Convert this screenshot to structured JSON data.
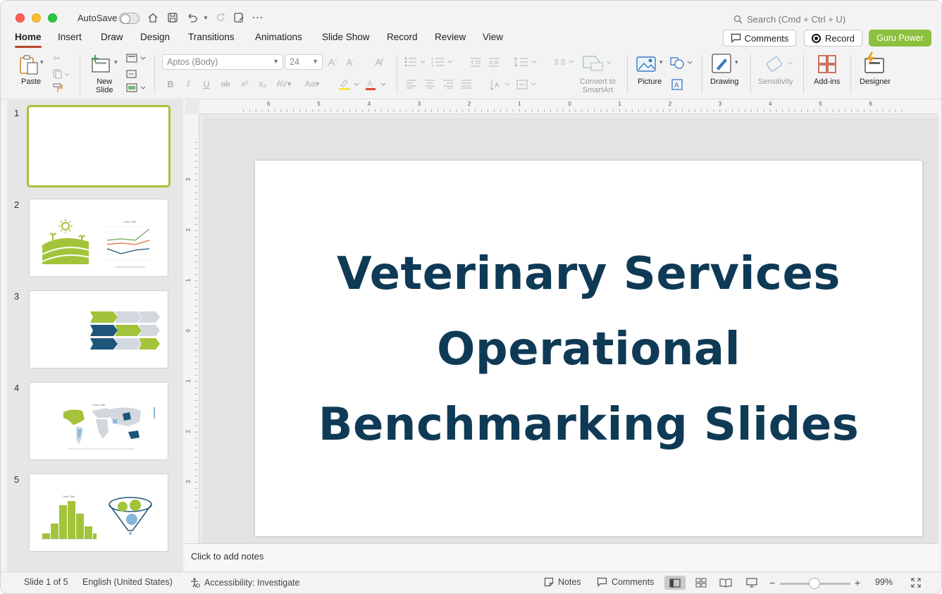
{
  "window": {
    "autosave_label": "AutoSave",
    "search_placeholder": "Search (Cmd + Ctrl + U)"
  },
  "tabs": [
    {
      "label": "Home",
      "active": true
    },
    {
      "label": "Insert"
    },
    {
      "label": "Draw"
    },
    {
      "label": "Design"
    },
    {
      "label": "Transitions"
    },
    {
      "label": "Animations"
    },
    {
      "label": "Slide Show"
    },
    {
      "label": "Record"
    },
    {
      "label": "Review"
    },
    {
      "label": "View"
    }
  ],
  "header_buttons": {
    "comments": "Comments",
    "record": "Record",
    "guru": "Guru Power"
  },
  "ribbon": {
    "paste": "Paste",
    "new_slide": "New\nSlide",
    "font_name": "Aptos (Body)",
    "font_size": "24",
    "convert_smartart": "Convert to\nSmartArt",
    "picture": "Picture",
    "drawing": "Drawing",
    "sensitivity": "Sensitivity",
    "add_ins": "Add-ins",
    "designer": "Designer"
  },
  "thumbnails": [
    {
      "number": "1",
      "selected": true
    },
    {
      "number": "2"
    },
    {
      "number": "3"
    },
    {
      "number": "4"
    },
    {
      "number": "5"
    }
  ],
  "slide": {
    "title_lines": [
      "Veterinary Services",
      "Operational",
      "Benchmarking Slides"
    ],
    "title_color": "#0f3a56"
  },
  "notes": {
    "placeholder": "Click to add notes"
  },
  "ruler": {
    "horizontal": [
      "6",
      "5",
      "4",
      "3",
      "2",
      "1",
      "0",
      "1",
      "2",
      "3",
      "4",
      "5",
      "6"
    ],
    "vertical": [
      "3",
      "2",
      "1",
      "0",
      "1",
      "2",
      "3"
    ]
  },
  "statusbar": {
    "slide_count": "Slide 1 of 5",
    "language": "English (United States)",
    "accessibility": "Accessibility: Investigate",
    "notes": "Notes",
    "comments": "Comments",
    "zoom": "99%"
  },
  "colors": {
    "accent_tab": "#b7472a",
    "guru_green": "#8cc13f",
    "thumb_green": "#a3c33a",
    "thumb_navy": "#1d5679",
    "thumb_gray": "#d3d8de"
  }
}
